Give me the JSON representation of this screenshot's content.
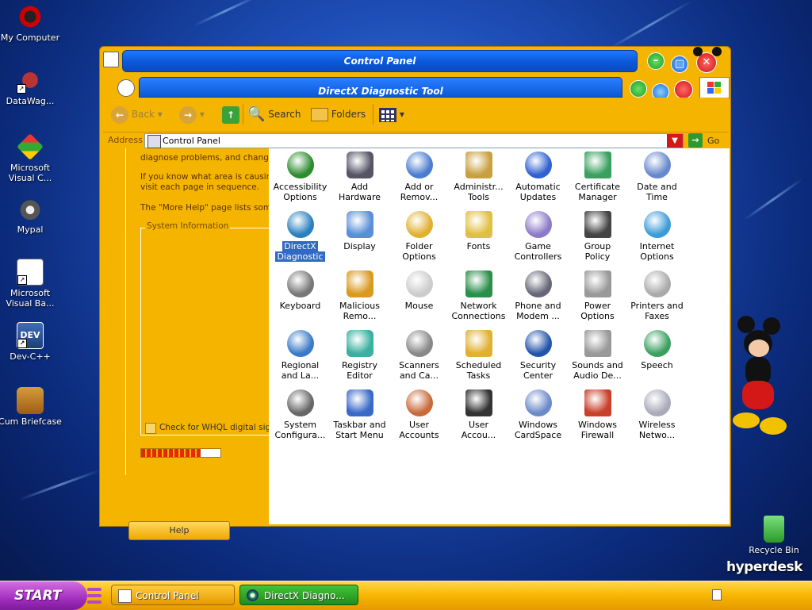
{
  "desktop": {
    "icons": [
      {
        "label": "My Computer"
      },
      {
        "label": "DataWag..."
      },
      {
        "label": "Microsoft Visual C..."
      },
      {
        "label": "Mypal"
      },
      {
        "label": "Microsoft Visual Ba..."
      },
      {
        "label": "Dev-C++"
      },
      {
        "label": "Cum Briefcase"
      }
    ],
    "recycle_bin": "Recycle Bin",
    "brand": "hyperdesk"
  },
  "control_panel": {
    "title": "Control Panel",
    "toolbar": {
      "back": "Back",
      "search": "Search",
      "folders": "Folders"
    },
    "address": {
      "label": "Address",
      "value": "Control Panel",
      "go": "Go"
    },
    "items": [
      {
        "line1": "Accessibility",
        "line2": "Options"
      },
      {
        "line1": "Add",
        "line2": "Hardware"
      },
      {
        "line1": "Add or",
        "line2": "Remov..."
      },
      {
        "line1": "Administr...",
        "line2": "Tools"
      },
      {
        "line1": "Automatic",
        "line2": "Updates"
      },
      {
        "line1": "Certificate",
        "line2": "Manager"
      },
      {
        "line1": "Date and",
        "line2": "Time"
      },
      {
        "line1": "DirectX",
        "line2": "Diagnostic"
      },
      {
        "line1": "Display",
        "line2": ""
      },
      {
        "line1": "Folder",
        "line2": "Options"
      },
      {
        "line1": "Fonts",
        "line2": ""
      },
      {
        "line1": "Game",
        "line2": "Controllers"
      },
      {
        "line1": "Group",
        "line2": "Policy"
      },
      {
        "line1": "Internet",
        "line2": "Options"
      },
      {
        "line1": "Keyboard",
        "line2": ""
      },
      {
        "line1": "Malicious",
        "line2": "Remo..."
      },
      {
        "line1": "Mouse",
        "line2": ""
      },
      {
        "line1": "Network",
        "line2": "Connections"
      },
      {
        "line1": "Phone and",
        "line2": "Modem ..."
      },
      {
        "line1": "Power",
        "line2": "Options"
      },
      {
        "line1": "Printers and",
        "line2": "Faxes"
      },
      {
        "line1": "Regional",
        "line2": "and La..."
      },
      {
        "line1": "Registry",
        "line2": "Editor"
      },
      {
        "line1": "Scanners",
        "line2": "and Ca..."
      },
      {
        "line1": "Scheduled",
        "line2": "Tasks"
      },
      {
        "line1": "Security",
        "line2": "Center"
      },
      {
        "line1": "Sounds and",
        "line2": "Audio De..."
      },
      {
        "line1": "Speech",
        "line2": ""
      },
      {
        "line1": "System",
        "line2": "Configura..."
      },
      {
        "line1": "Taskbar and",
        "line2": "Start Menu"
      },
      {
        "line1": "User",
        "line2": "Accounts"
      },
      {
        "line1": "User",
        "line2": "Accou..."
      },
      {
        "line1": "Windows",
        "line2": "CardSpace"
      },
      {
        "line1": "Windows",
        "line2": "Firewall"
      },
      {
        "line1": "Wireless",
        "line2": "Netwo..."
      }
    ],
    "selected_index": 7
  },
  "dxdiag": {
    "title": "DirectX Diagnostic Tool",
    "text1": "diagnose problems, and change yo",
    "text2": "If you know what area is causing t",
    "text3": "visit each page in sequence.",
    "text4": "The \"More Help\" page lists some ot",
    "group_label": "System Information",
    "checkbox_label": "Check for WHQL digital signa",
    "help_button": "Help",
    "progress": 0.75
  },
  "taskbar": {
    "start": "START",
    "items": [
      {
        "label": "Control Panel"
      },
      {
        "label": "DirectX Diagno..."
      }
    ]
  }
}
